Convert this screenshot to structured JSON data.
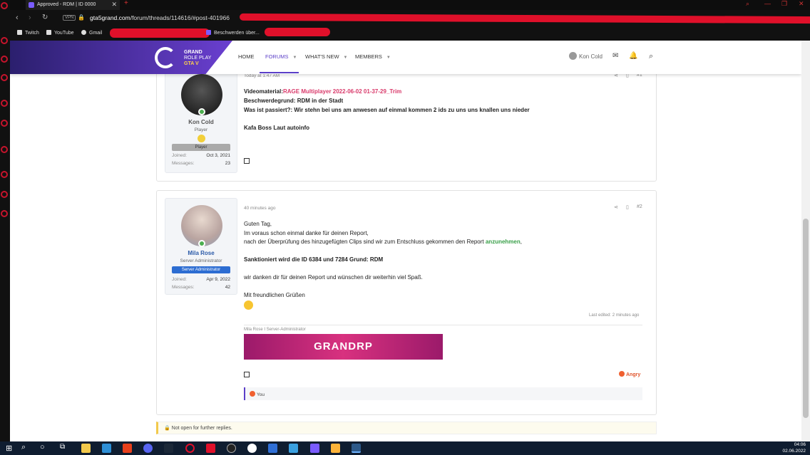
{
  "browser": {
    "tab_title": "Approved - RDM | ID 0000",
    "url_domain": "gta5grand.com",
    "url_path": "/forum/threads/114616/#post-401966"
  },
  "bookmarks": [
    "Twitch",
    "YouTube",
    "Gmail",
    "Beschwerden über..."
  ],
  "site": {
    "logo_line1": "GRAND",
    "logo_line2": "ROLE PLAY",
    "logo_line3": "GTA V",
    "nav": [
      "HOME",
      "FORUMS",
      "WHAT'S NEW",
      "MEMBERS"
    ],
    "user": "Kon Cold"
  },
  "post1": {
    "time": "Today at 1:47 AM",
    "number": "#1",
    "author": "Kon Cold",
    "title": "Player",
    "banner": "Player",
    "joined_label": "Joined:",
    "joined": "Oct 3, 2021",
    "messages_label": "Messages:",
    "messages": "23",
    "lines": [
      {
        "label": "Videomaterial:",
        "value": "RAGE Multiplayer 2022-06-02 01-37-29_Trim"
      },
      {
        "label": "Beschwerdegrund:",
        "value": " RDM in der Stadt"
      },
      {
        "label": "Was ist passiert?:",
        "value": " Wir stehn bei uns am anwesen auf einmal kommen 2 ids zu uns uns knallen uns nieder"
      }
    ],
    "extra": "Kafa Boss Laut autoinfo"
  },
  "post2": {
    "time": "40 minutes ago",
    "number": "#2",
    "author": "Mila Rose",
    "title": "Server Administrator",
    "banner": "Server Administrator",
    "joined_label": "Joined:",
    "joined": "Apr 9, 2022",
    "messages_label": "Messages:",
    "messages": "42",
    "l1": "Guten Tag,",
    "l2": "Im voraus schon einmal danke für deinen Report,",
    "l3a": "nach der Überprüfung des hinzugefügten Clips sind wir zum Entschluss gekommen den Report ",
    "l3b": "anzunehmen",
    "l3c": ",",
    "l4": "Sanktioniert wird die ID 6384 und 7284 Grund: RDM",
    "l5": "wir danken dir für deinen Report und wünschen dir weiterhin viel Spaß.",
    "l6": "Mit freundlichen Grüßen",
    "edited": "Last edited: 2 minutes ago",
    "sig_label": "Mila Rose I Server-Administrator",
    "sig_banner": "GRANDRP",
    "reaction": "Angry",
    "reacted": "You"
  },
  "notice": "Not open for further replies.",
  "clock": {
    "time": "04:06",
    "date": "02.06.2022"
  }
}
